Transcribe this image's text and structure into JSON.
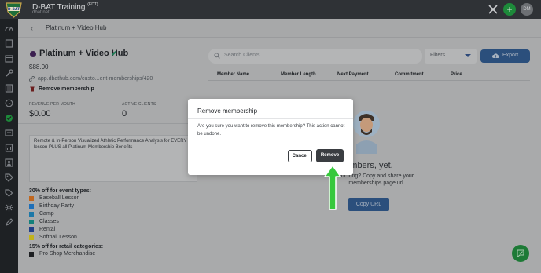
{
  "app": {
    "title": "D-BAT Training",
    "title_suffix": "(EDT)",
    "url": "dbat.net/",
    "avatar_initials": "DM",
    "plus_label": "+"
  },
  "subheader": {
    "title": "Platinum + Video Hub"
  },
  "membership": {
    "name": "Platinum + Video Hub",
    "price": "$88.00",
    "link": "app.dbathub.com/custo...ent-memberships/420",
    "remove_label": "Remove membership",
    "stats": [
      {
        "label": "REVENUE PER MONTH",
        "value": "$0.00"
      },
      {
        "label": "ACTIVE CLIENTS",
        "value": "0"
      }
    ],
    "description": "Remote & In-Person Visualized Athletic Performance Analysis for EVERY lesson PLUS all Platinum Membership Benefits"
  },
  "discounts": {
    "event_heading": "30% off for event types:",
    "event_types": [
      {
        "label": "Baseball Lesson",
        "color": "#c0671f"
      },
      {
        "label": "Birthday Party",
        "color": "#1e6fb8"
      },
      {
        "label": "Camp",
        "color": "#1c78a8"
      },
      {
        "label": "Classes",
        "color": "#13807a"
      },
      {
        "label": "Rental",
        "color": "#1f3e88"
      },
      {
        "label": "Softball Lesson",
        "color": "#c2b31c"
      }
    ],
    "retail_heading": "15% off for retail categories:",
    "retail_categories": [
      {
        "label": "Pro Shop Merchandise",
        "color": "#1d1f22"
      }
    ]
  },
  "clients": {
    "search_placeholder": "Search Clients",
    "filters_label": "Filters",
    "export_label": "Export",
    "columns": [
      "Member Name",
      "Member Length",
      "Next Payment",
      "Commitment",
      "Price"
    ],
    "empty_title": "members, yet.",
    "empty_sub": "for long? Copy and share your memberships page url.",
    "copy_url_label": "Copy URL"
  },
  "modal": {
    "title": "Remove membership",
    "body": "Are you sure you want to remove this membership? This action cannot be undone.",
    "cancel_label": "Cancel",
    "remove_label": "Remove"
  },
  "colors": {
    "brand_green": "#1d8a3a",
    "arrow_green": "#37c83d",
    "export_blue": "#2b4f7c"
  }
}
